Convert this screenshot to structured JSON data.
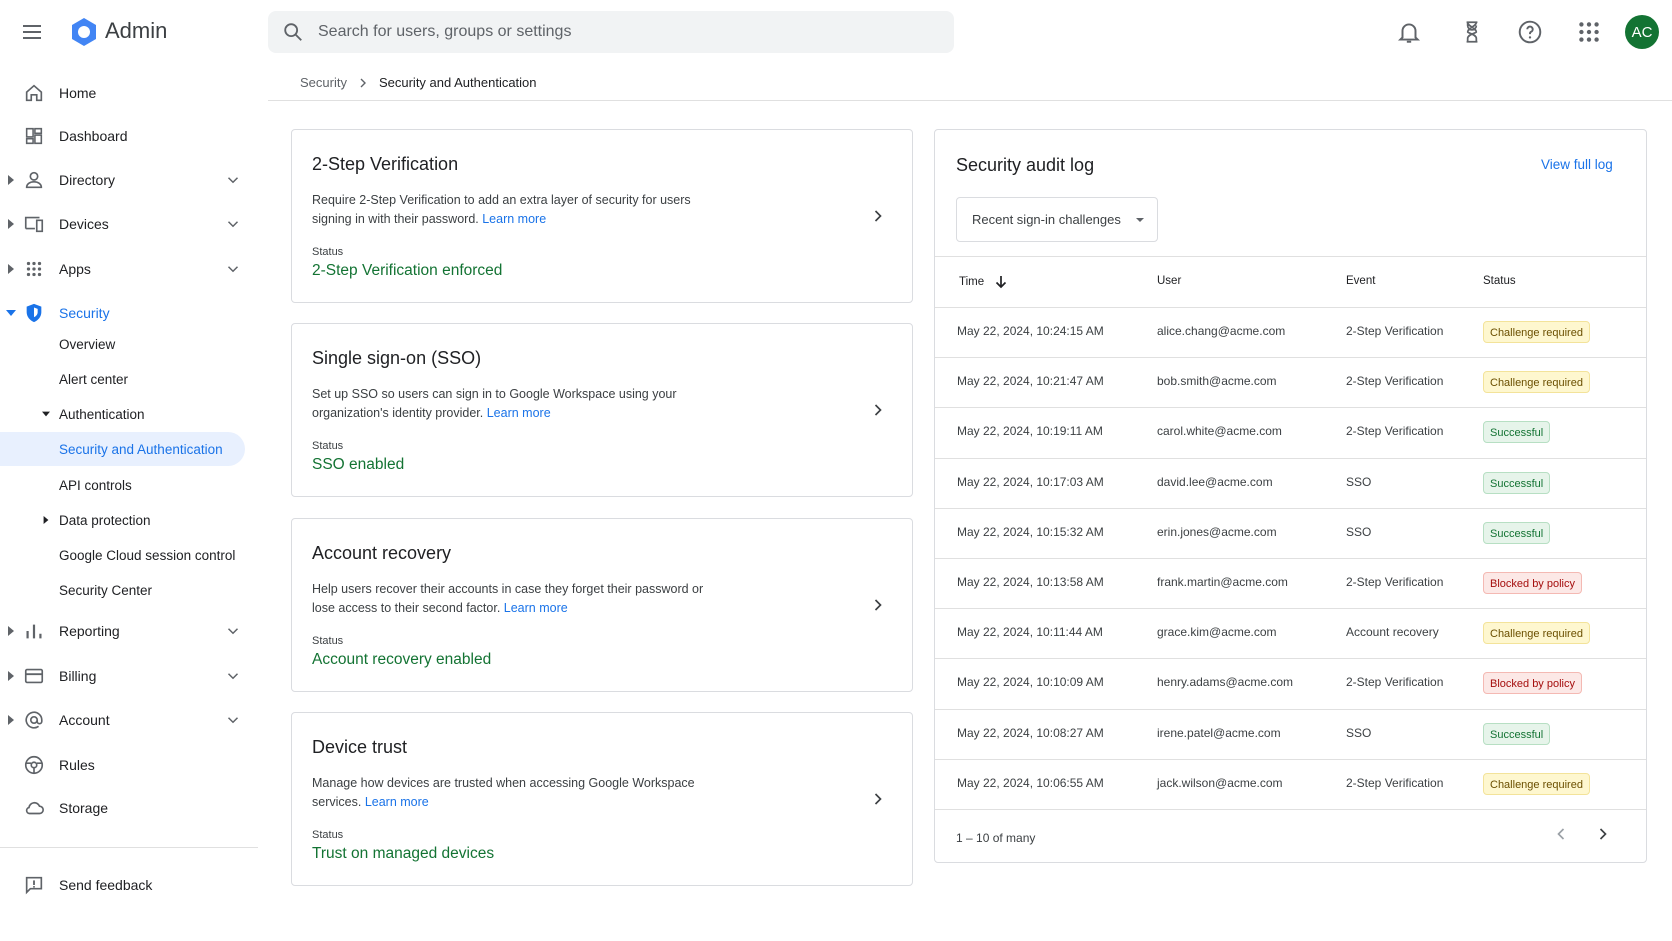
{
  "app": {
    "title": "Admin"
  },
  "search": {
    "placeholder": "Search for users, groups or settings"
  },
  "header": {
    "avatar_initials": "AC"
  },
  "colors": {
    "accent": "#1a73e8",
    "success": "#137333",
    "avatar_bg": "#137333"
  },
  "sidebar": {
    "items": [
      {
        "label": "Home",
        "icon": "home-icon"
      },
      {
        "label": "Dashboard",
        "icon": "dashboard-icon"
      },
      {
        "label": "Directory",
        "icon": "person-icon"
      },
      {
        "label": "Devices",
        "icon": "devices-icon"
      },
      {
        "label": "Apps",
        "icon": "apps-grid-icon"
      },
      {
        "label": "Security",
        "icon": "shield-icon"
      },
      {
        "label": "Reporting",
        "icon": "bar-chart-icon"
      },
      {
        "label": "Billing",
        "icon": "credit-card-icon"
      },
      {
        "label": "Account",
        "icon": "at-sign-icon"
      },
      {
        "label": "Rules",
        "icon": "rules-icon"
      },
      {
        "label": "Storage",
        "icon": "cloud-icon"
      }
    ],
    "security_sub": [
      {
        "label": "Overview"
      },
      {
        "label": "Alert center"
      },
      {
        "label": "Authentication"
      },
      {
        "label": "Security and Authentication"
      },
      {
        "label": "API controls"
      },
      {
        "label": "Data protection"
      },
      {
        "label": "Google Cloud session control"
      },
      {
        "label": "Security Center"
      }
    ],
    "feedback": {
      "label": "Send feedback",
      "icon": "feedback-icon"
    }
  },
  "breadcrumb": {
    "parent": "Security",
    "current": "Security and Authentication"
  },
  "cards": [
    {
      "title": "2-Step Verification",
      "description": "Require 2-Step Verification to add an extra layer of security for users signing in with their password.",
      "link": "Learn more",
      "status_label": "Status",
      "status": "2-Step Verification enforced"
    },
    {
      "title": "Single sign-on (SSO)",
      "description": "Set up SSO so users can sign in to Google Workspace using your organization's identity provider.",
      "link": "Learn more",
      "status_label": "Status",
      "status": "SSO enabled"
    },
    {
      "title": "Account recovery",
      "description": "Help users recover their accounts in case they forget their password or lose access to their second factor.",
      "link": "Learn more",
      "status_label": "Status",
      "status": "Account recovery enabled"
    },
    {
      "title": "Device trust",
      "description": "Manage how devices are trusted when accessing Google Workspace services.",
      "link": "Learn more",
      "status_label": "Status",
      "status": "Trust on managed devices"
    }
  ],
  "audit": {
    "title": "Security audit log",
    "view_all": "View full log",
    "filter": "Recent sign-in challenges",
    "columns": {
      "time": "Time",
      "user": "User",
      "event": "Event",
      "status": "Status"
    },
    "rows": [
      {
        "time": "May 22, 2024, 10:24:15 AM",
        "user": "alice.chang@acme.com",
        "event": "2-Step Verification",
        "status": "Challenge required",
        "kind": "warn"
      },
      {
        "time": "May 22, 2024, 10:21:47 AM",
        "user": "bob.smith@acme.com",
        "event": "2-Step Verification",
        "status": "Challenge required",
        "kind": "warn"
      },
      {
        "time": "May 22, 2024, 10:19:11 AM",
        "user": "carol.white@acme.com",
        "event": "2-Step Verification",
        "status": "Successful",
        "kind": "ok"
      },
      {
        "time": "May 22, 2024, 10:17:03 AM",
        "user": "david.lee@acme.com",
        "event": "SSO",
        "status": "Successful",
        "kind": "ok"
      },
      {
        "time": "May 22, 2024, 10:15:32 AM",
        "user": "erin.jones@acme.com",
        "event": "SSO",
        "status": "Successful",
        "kind": "ok"
      },
      {
        "time": "May 22, 2024, 10:13:58 AM",
        "user": "frank.martin@acme.com",
        "event": "2-Step Verification",
        "status": "Blocked by policy",
        "kind": "bad"
      },
      {
        "time": "May 22, 2024, 10:11:44 AM",
        "user": "grace.kim@acme.com",
        "event": "Account recovery",
        "status": "Challenge required",
        "kind": "warn"
      },
      {
        "time": "May 22, 2024, 10:10:09 AM",
        "user": "henry.adams@acme.com",
        "event": "2-Step Verification",
        "status": "Blocked by policy",
        "kind": "bad"
      },
      {
        "time": "May 22, 2024, 10:08:27 AM",
        "user": "irene.patel@acme.com",
        "event": "SSO",
        "status": "Successful",
        "kind": "ok"
      },
      {
        "time": "May 22, 2024, 10:06:55 AM",
        "user": "jack.wilson@acme.com",
        "event": "2-Step Verification",
        "status": "Challenge required",
        "kind": "warn"
      }
    ],
    "pagination": "1 – 10 of many"
  }
}
